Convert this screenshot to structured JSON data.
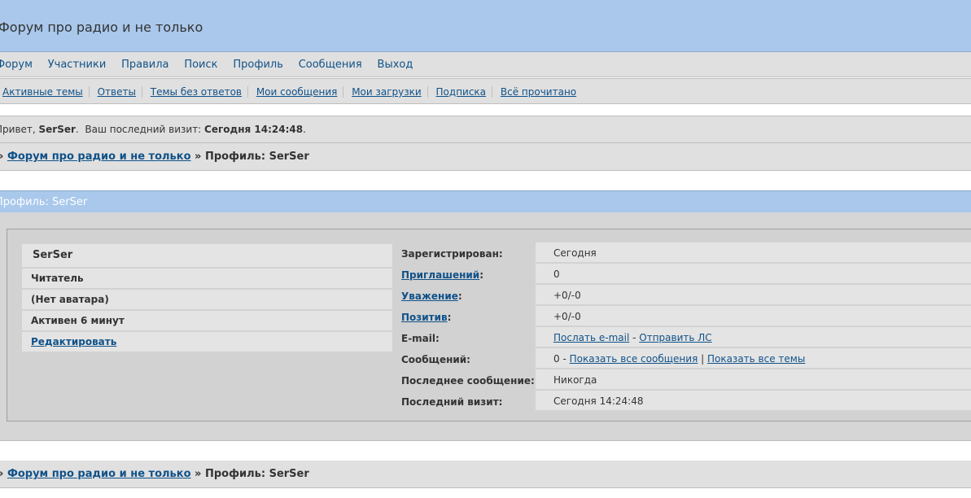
{
  "header": {
    "title": "Форум про радио и не только"
  },
  "nav_main": [
    "Форум",
    "Участники",
    "Правила",
    "Поиск",
    "Профиль",
    "Сообщения",
    "Выход"
  ],
  "nav_sub": [
    "Активные темы",
    "Ответы",
    "Темы без ответов",
    "Мои сообщения",
    "Мои загрузки",
    "Подписка",
    "Всё прочитано"
  ],
  "greeting": {
    "prefix": "Привет, ",
    "user": "SerSer",
    "middle": ".  Ваш последний визит: ",
    "last_visit": "Сегодня 14:24:48",
    "suffix": "."
  },
  "breadcrumb": {
    "arrow": "»",
    "forum": "Форум про радио и не только",
    "sep": "»",
    "current": "Профиль: SerSer"
  },
  "section": {
    "title": "Профиль: SerSer"
  },
  "profile": {
    "username": "SerSer",
    "rank": "Читатель",
    "avatar": "(Нет аватара)",
    "active": "Активен 6 минут",
    "edit": "Редактировать"
  },
  "details": {
    "registered_label": "Зарегистрирован:",
    "registered_value": "Сегодня",
    "invites_label": "Приглашений",
    "invites_value": "0",
    "respect_label": "Уважение",
    "respect_value": "+0/-0",
    "positive_label": "Позитив",
    "positive_value": "+0/-0",
    "email_label": "E-mail:",
    "email_send": "Послать e-mail",
    "email_sep": " - ",
    "send_pm": "Отправить ЛС",
    "posts_label": "Сообщений:",
    "posts_count": "0",
    "posts_sep": " - ",
    "show_all_posts": "Показать все сообщения",
    "posts_pipe": " | ",
    "show_all_topics": "Показать все темы",
    "last_post_label": "Последнее сообщение:",
    "last_post_value": "Никогда",
    "last_visit_label": "Последний визит:",
    "last_visit_value": "Сегодня 14:24:48",
    "colon": ":"
  },
  "colors": {
    "header_blue": "#a9c8ec",
    "link": "#105289",
    "panel_gray": "#e0e0e0"
  }
}
